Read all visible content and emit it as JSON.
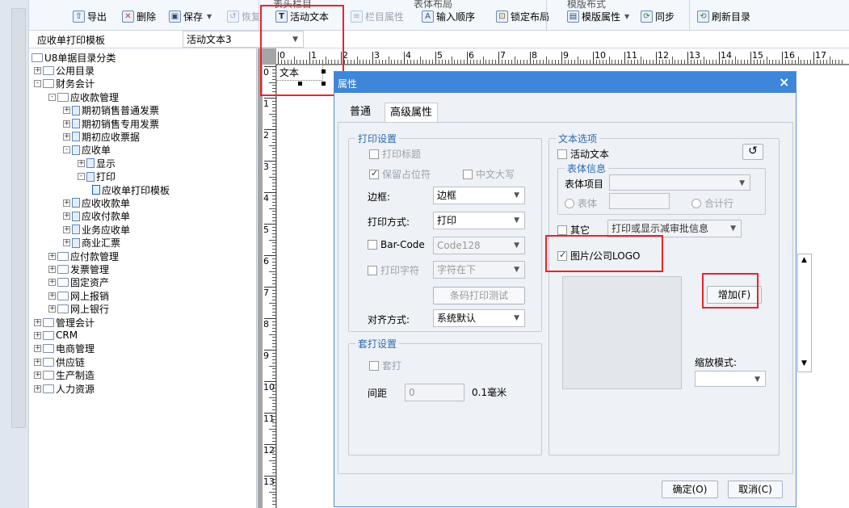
{
  "toolbar": {
    "export": "导出",
    "delete": "删除",
    "save": "保存",
    "restore": "恢复",
    "active_text": "活动文本",
    "column_props": "栏目属性",
    "input_order": "输入顺序",
    "lock_layout": "锁定布局",
    "template_props": "模版属性",
    "sync": "同步",
    "refresh_dir": "刷新目录",
    "top_partial_1": "表头栏目",
    "top_partial_2": "表体布局",
    "top_partial_3": "模版布式"
  },
  "selectors": {
    "template_name": "应收单打印模板",
    "object_name": "活动文本3"
  },
  "tree": {
    "items": [
      {
        "label": "U8单据目录分类",
        "level": 0,
        "exp": "",
        "kind": "folder"
      },
      {
        "label": "公用目录",
        "level": 1,
        "exp": "+",
        "kind": "folder"
      },
      {
        "label": "财务会计",
        "level": 1,
        "exp": "-",
        "kind": "folder"
      },
      {
        "label": "应收款管理",
        "level": 2,
        "exp": "-",
        "kind": "folder"
      },
      {
        "label": "期初销售普通发票",
        "level": 3,
        "exp": "+",
        "kind": "doc"
      },
      {
        "label": "期初销售专用发票",
        "level": 3,
        "exp": "+",
        "kind": "doc"
      },
      {
        "label": "期初应收票据",
        "level": 3,
        "exp": "+",
        "kind": "doc"
      },
      {
        "label": "应收单",
        "level": 3,
        "exp": "-",
        "kind": "doc"
      },
      {
        "label": "显示",
        "level": 4,
        "exp": "+",
        "kind": "doc"
      },
      {
        "label": "打印",
        "level": 4,
        "exp": "-",
        "kind": "doc"
      },
      {
        "label": "应收单打印模板",
        "level": 5,
        "exp": "",
        "kind": "tpl"
      },
      {
        "label": "应收收款单",
        "level": 3,
        "exp": "+",
        "kind": "doc"
      },
      {
        "label": "应收付款单",
        "level": 3,
        "exp": "+",
        "kind": "doc"
      },
      {
        "label": "业务应收单",
        "level": 3,
        "exp": "+",
        "kind": "doc"
      },
      {
        "label": "商业汇票",
        "level": 3,
        "exp": "+",
        "kind": "doc"
      },
      {
        "label": "应付款管理",
        "level": 2,
        "exp": "+",
        "kind": "folder"
      },
      {
        "label": "发票管理",
        "level": 2,
        "exp": "+",
        "kind": "folder"
      },
      {
        "label": "固定资产",
        "level": 2,
        "exp": "+",
        "kind": "folder"
      },
      {
        "label": "网上报销",
        "level": 2,
        "exp": "+",
        "kind": "folder"
      },
      {
        "label": "网上银行",
        "level": 2,
        "exp": "+",
        "kind": "folder"
      },
      {
        "label": "管理会计",
        "level": 1,
        "exp": "+",
        "kind": "folder"
      },
      {
        "label": "CRM",
        "level": 1,
        "exp": "+",
        "kind": "folder"
      },
      {
        "label": "电商管理",
        "level": 1,
        "exp": "+",
        "kind": "folder"
      },
      {
        "label": "供应链",
        "level": 1,
        "exp": "+",
        "kind": "folder"
      },
      {
        "label": "生产制造",
        "level": 1,
        "exp": "+",
        "kind": "folder"
      },
      {
        "label": "人力资源",
        "level": 1,
        "exp": "+",
        "kind": "folder"
      }
    ]
  },
  "canvas": {
    "text_object": "文本",
    "ruler_top": [
      "0",
      "1",
      "2",
      "3",
      "4",
      "5",
      "6",
      "7",
      "8",
      "9",
      "10",
      "11",
      "12",
      "13",
      "14",
      "15",
      "16",
      "17"
    ],
    "ruler_left": [
      "0",
      "1",
      "2",
      "3",
      "4",
      "5",
      "6",
      "7",
      "8",
      "9",
      "10",
      "11",
      "12",
      "13"
    ]
  },
  "dialog": {
    "title": "属性",
    "close": "×",
    "tabs": {
      "normal": "普通",
      "advanced": "高级属性"
    },
    "print_settings": {
      "legend": "打印设置",
      "print_title": "打印标题",
      "keep_placeholder": "保留占位符",
      "chinese_upper": "中文大写",
      "border_label": "边框:",
      "border_value": "边框",
      "print_mode_label": "打印方式:",
      "print_mode_value": "打印",
      "barcode_label": "Bar-Code",
      "barcode_value": "Code128",
      "print_chars_label": "打印字符",
      "print_chars_value": "字符在下",
      "barcode_test": "条码打印测试",
      "align_label": "对齐方式:",
      "align_value": "系统默认"
    },
    "overlay": {
      "legend": "套打设置",
      "overlay_label": "套打",
      "spacing_label": "间距",
      "spacing_value": "0",
      "spacing_unit": "0.1毫米"
    },
    "text_options": {
      "legend": "文本选项",
      "active_text": "活动文本",
      "body_info_legend": "表体信息",
      "body_item_label": "表体项目",
      "body_radio": "表体",
      "total_row": "合计行",
      "other": "其它",
      "other_value": "打印或显示减审批信息",
      "logo": "图片/公司LOGO",
      "add_button": "增加(F)",
      "scale_mode": "缩放模式:"
    },
    "ok": "确定(O)",
    "cancel": "取消(C)"
  }
}
